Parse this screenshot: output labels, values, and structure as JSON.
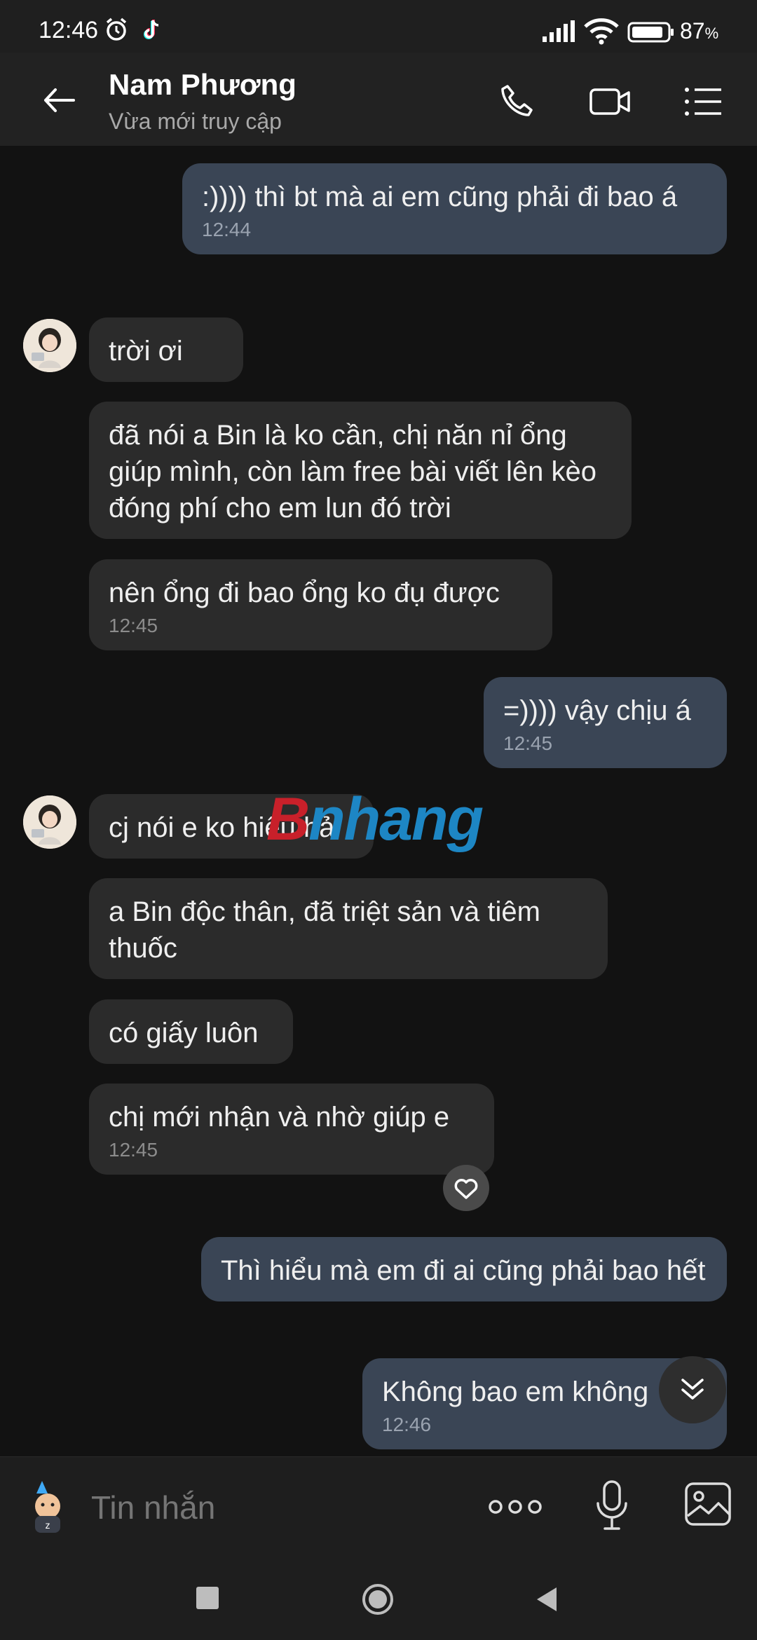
{
  "status_bar": {
    "time": "12:46",
    "battery": "87",
    "battery_unit": "%"
  },
  "header": {
    "name": "Nam Phương",
    "status": "Vừa mới truy cập"
  },
  "messages": [
    {
      "text": ":)))) thì bt mà ai em cũng phải đi bao á",
      "time": "12:44"
    },
    {
      "text": "trời ơi"
    },
    {
      "text": "đã nói a Bin là ko cần, chị năn nỉ ổng giúp mình, còn làm free bài viết lên kèo đóng phí cho em lun đó trời"
    },
    {
      "text": "nên ổng đi bao ổng ko đụ được",
      "time": "12:45"
    },
    {
      "text": "=)))) vậy chịu á",
      "time": "12:45"
    },
    {
      "text": "cj nói e ko hiểu hả"
    },
    {
      "text": "a Bin độc thân, đã triệt sản và tiêm thuốc"
    },
    {
      "text": "có giấy luôn"
    },
    {
      "text": "chị mới nhận và nhờ giúp e",
      "time": "12:45"
    },
    {
      "text": "Thì hiểu mà em đi ai cũng phải bao hết"
    },
    {
      "text": "Không bao em không",
      "time": "12:46"
    }
  ],
  "watermark": {
    "first": "B",
    "rest": "nhang"
  },
  "composer": {
    "placeholder": "Tin nhắn"
  },
  "colors": {
    "outgoing_bubble": "#3a4555",
    "incoming_bubble": "#2b2b2b",
    "background": "#121212",
    "header": "#222222"
  }
}
